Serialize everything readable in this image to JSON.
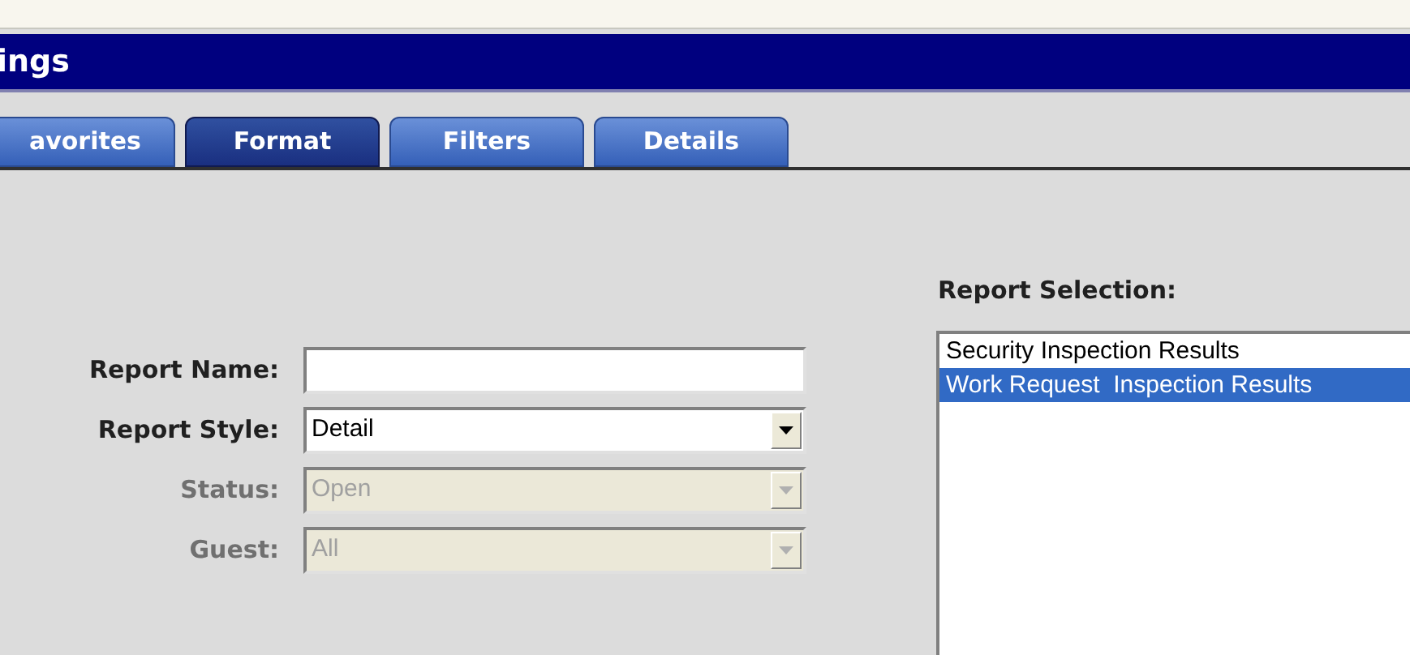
{
  "window": {
    "title": "ings"
  },
  "tabs": [
    {
      "label": "avorites",
      "selected": false
    },
    {
      "label": "Format",
      "selected": true
    },
    {
      "label": "Filters",
      "selected": false
    },
    {
      "label": "Details",
      "selected": false
    }
  ],
  "form": {
    "fields": [
      {
        "kind": "text",
        "label": "Report Name:",
        "disabled": false
      },
      {
        "kind": "dropdown",
        "label": "Report Style:",
        "value": "Detail",
        "disabled": false
      },
      {
        "kind": "dropdown",
        "label": "Status:",
        "value": "Open",
        "disabled": true
      },
      {
        "kind": "dropdown",
        "label": "Guest:",
        "value": "All",
        "disabled": true
      }
    ]
  },
  "report_selection": {
    "label": "Report Selection:",
    "items": [
      {
        "label": "Security Inspection Results",
        "selected": false
      },
      {
        "label": "Work Request  Inspection Results",
        "selected": true
      }
    ]
  }
}
